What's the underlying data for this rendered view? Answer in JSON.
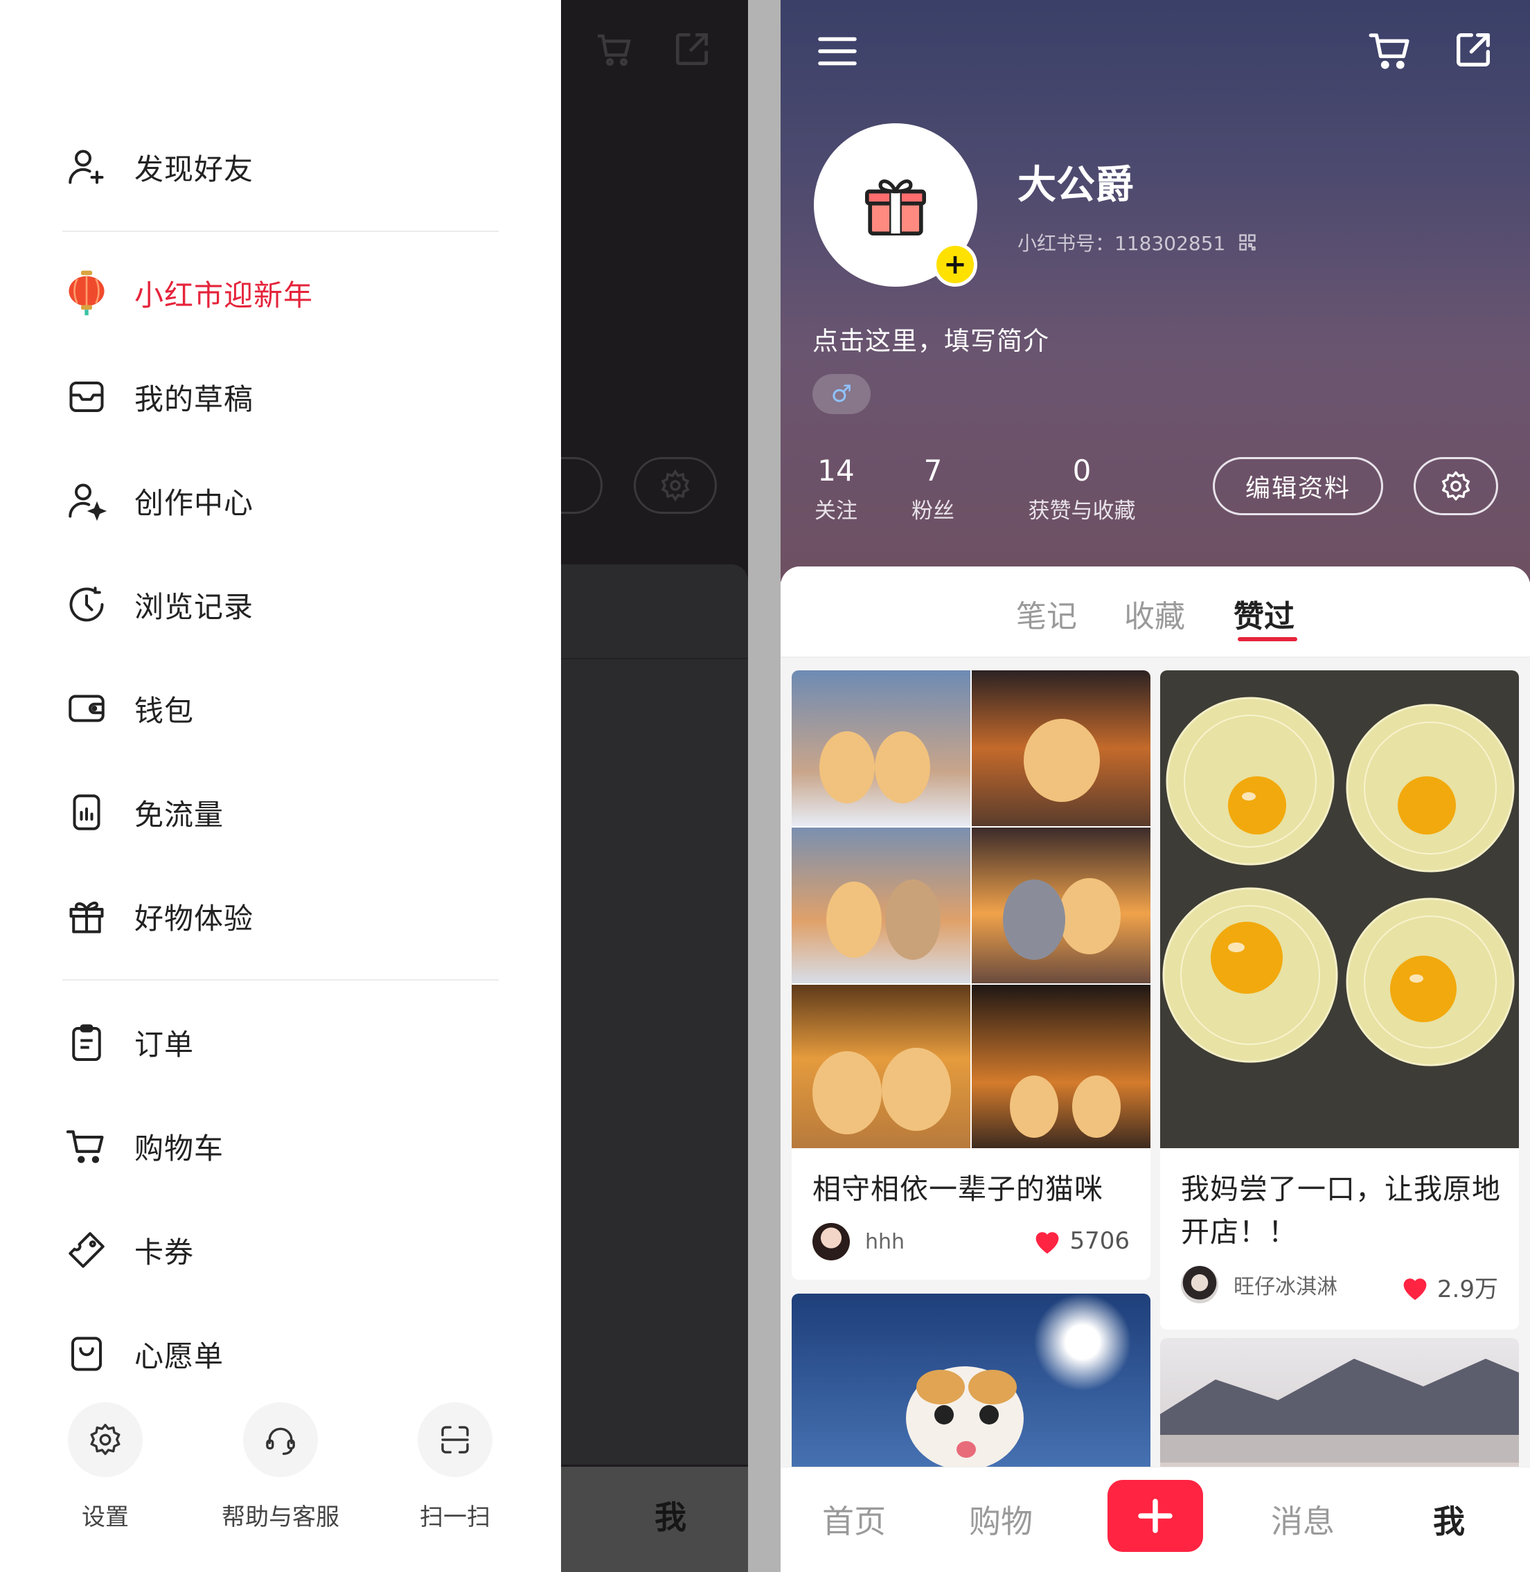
{
  "drawer": {
    "items": [
      {
        "label": "发现好友",
        "icon": "add-friend-icon"
      },
      {
        "label": "小红市迎新年",
        "icon": "lantern-icon"
      },
      {
        "label": "我的草稿",
        "icon": "draft-box-icon"
      },
      {
        "label": "创作中心",
        "icon": "creator-icon"
      },
      {
        "label": "浏览记录",
        "icon": "history-clock-icon"
      },
      {
        "label": "钱包",
        "icon": "wallet-icon"
      },
      {
        "label": "免流量",
        "icon": "data-free-icon"
      },
      {
        "label": "好物体验",
        "icon": "gift-box-icon"
      },
      {
        "label": "订单",
        "icon": "order-clipboard-icon"
      },
      {
        "label": "购物车",
        "icon": "cart-icon"
      },
      {
        "label": "卡券",
        "icon": "coupon-icon"
      },
      {
        "label": "心愿单",
        "icon": "wishlist-bag-icon"
      }
    ],
    "tools": [
      {
        "label": "设置",
        "icon": "settings-gear-icon"
      },
      {
        "label": "帮助与客服",
        "icon": "headset-icon"
      },
      {
        "label": "扫一扫",
        "icon": "scan-icon"
      }
    ],
    "highlight_color": "#e5243b"
  },
  "background_screen": {
    "nav_me": "我"
  },
  "profile": {
    "nickname": "大公爵",
    "user_id": "小红书号：118302851",
    "bio": "点击这里，填写简介",
    "gender_symbol": "♂",
    "stats": [
      {
        "value": "14",
        "label": "关注"
      },
      {
        "value": "7",
        "label": "粉丝"
      },
      {
        "value": "0",
        "label": "获赞与收藏"
      }
    ],
    "edit_label": "编辑资料"
  },
  "tabs": [
    {
      "label": "笔记",
      "active": false
    },
    {
      "label": "收藏",
      "active": false
    },
    {
      "label": "赞过",
      "active": true
    }
  ],
  "notes": [
    {
      "title": "相守相依一辈子的猫咪",
      "author": "hhh",
      "likes": "5706"
    },
    {
      "title": "我妈尝了一口，让我原地开店！！",
      "author": "旺仔冰淇淋",
      "likes": "2.9万"
    }
  ],
  "bottom_nav": [
    {
      "label": "首页",
      "active": false
    },
    {
      "label": "购物",
      "active": false
    },
    {
      "label": "消息",
      "active": false
    },
    {
      "label": "我",
      "active": true
    }
  ],
  "colors": {
    "accent": "#ff2442",
    "like": "#ff2442"
  }
}
